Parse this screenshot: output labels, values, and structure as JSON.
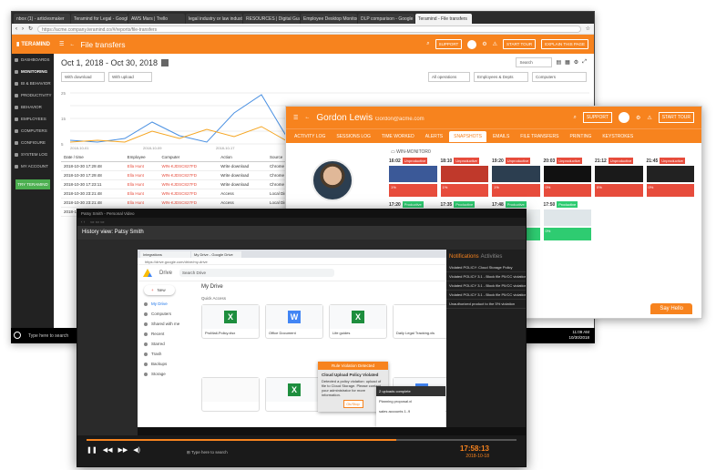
{
  "win1": {
    "tabs": [
      "nbox (1) - articlesmaker",
      "Teramind for Legal - Google",
      "AWS Mars | Trello",
      "legal industry or law indust",
      "RESOURCES | Digital Guardi",
      "Employee Desktop Monitor",
      "DLP comparison - Google D",
      "Teramind - File transfers"
    ],
    "url": "https://acme.company.teramind.co/#/reports/file-transfers",
    "logo": "TERAMIND",
    "nav": [
      "DASHBOARDS",
      "MONITORING",
      "BI & BEHAVIOR",
      "PRODUCTIVITY",
      "BEHAVIOR",
      "EMPLOYEES",
      "COMPUTERS",
      "CONFIGURE",
      "SYSTEM LOG",
      "MY ACCOUNT"
    ],
    "nav_active": "MONITORING",
    "trial_button": "TRY TERAMIND",
    "header_title": "File transfers",
    "support": "SUPPORT",
    "start_tour": "START TOUR",
    "explain": "EXPLAIN THIS PAGE",
    "date_range": "Oct 1, 2018 - Oct 30, 2018",
    "search_placeholder": "Search",
    "filters": [
      "With download",
      "With upload",
      "All operations",
      "Employees & Depts",
      "Computers"
    ],
    "columns": [
      "Date / time",
      "Employee",
      "Computer",
      "Action",
      "Source"
    ],
    "rows": [
      [
        "2018-10-30 17:29:48",
        "Ella Hunt",
        "WIN-KJDSC827FD",
        "Write download",
        "Chrome"
      ],
      [
        "2018-10-30 17:29:48",
        "Ella Hunt",
        "WIN-KJDSC827FD",
        "Write download",
        "Chrome"
      ],
      [
        "2018-10-30 17:23:11",
        "Ella Hunt",
        "WIN-KJDSC827FD",
        "Write download",
        "Chrome"
      ],
      [
        "2018-10-30 23:21:48",
        "Ella Hunt",
        "WIN-KJDSC827FD",
        "Access",
        "Local Disk"
      ],
      [
        "2018-10-30 23:21:48",
        "Ella Hunt",
        "WIN-KJDSC827FD",
        "Access",
        "Local Disk"
      ],
      [
        "2018-10-30 23:21:48",
        "Ella Hunt",
        "WIN-KJDSC827FD",
        "Access",
        "Local Disk"
      ]
    ],
    "chart_x": [
      "2018-10-01",
      "2018-10-05",
      "2018-10-09",
      "2018-10-13",
      "2018-10-17",
      "2018-10-21",
      "2018-10-25",
      "2018-10-29"
    ],
    "chart_y": [
      "25",
      "20",
      "15",
      "10",
      "5"
    ]
  },
  "win2": {
    "name": "Gordon Lewis",
    "email": "Gordon@acme.com",
    "support": "SUPPORT",
    "start_tour": "START TOUR",
    "tabs": [
      "ACTIVITY LOG",
      "SESSIONS LOG",
      "TIME WORKED",
      "ALERTS",
      "SNAPSHOTS",
      "EMAILS",
      "FILE TRANSFERS",
      "PRINTING",
      "KEYSTROKES"
    ],
    "active_tab": "SNAPSHOTS",
    "monitor_label": "WIN-MONITOR0",
    "snapshots": [
      {
        "time": "16:02",
        "badge": "Unproductive",
        "pct": "1%"
      },
      {
        "time": "18:10",
        "badge": "Unproductive",
        "pct": "1%"
      },
      {
        "time": "19:20",
        "badge": "Unproductive",
        "pct": "1%"
      },
      {
        "time": "20:03",
        "badge": "Unproductive",
        "pct": "0%"
      },
      {
        "time": "21:12",
        "badge": "Unproductive",
        "pct": "0%"
      },
      {
        "time": "21:45",
        "badge": "Unproductive",
        "pct": "0%"
      },
      {
        "time": "17:20",
        "badge": "Productive",
        "pct": "1%"
      },
      {
        "time": "17:35",
        "badge": "Productive",
        "pct": "0%"
      },
      {
        "time": "17:48",
        "badge": "Productive",
        "pct": "0%"
      },
      {
        "time": "17:50",
        "badge": "Productive",
        "pct": "0%"
      }
    ],
    "say_hello": "Say Hello"
  },
  "win3": {
    "title": "Patsy Smith - Personal Video",
    "history": "History view: Patsy Smith",
    "drive_tabs": [
      "Integrations",
      "My Drive - Google Drive"
    ],
    "drive_url": "https://drive.google.com/drive/my-drive",
    "drive_search": "Search Drive",
    "my_drive": "My Drive",
    "quick_access": "Quick Access",
    "side": [
      "New",
      "My Drive",
      "Computers",
      "Shared with me",
      "Recent",
      "Starred",
      "Trash",
      "Backups",
      "Storage"
    ],
    "files": [
      "ProMail-Policy.xlsx",
      "Office Document",
      "Life guides",
      "Daily Legal Tracking.xls"
    ],
    "dialog_title": "Rule Violation Detected",
    "dialog_heading": "Cloud Upload Policy Violated",
    "dialog_body": "Detected a policy violation: upload of file to Cloud Storage. Please contact your administrator for more information.",
    "dialog_ok": "Ok/Stop",
    "upload_title": "2 uploads complete",
    "upload_items": [
      "Planning proposal.xl",
      "sales accounts 1..9"
    ],
    "notif_title": "Notifications",
    "notif_tab": "Activities",
    "notif_items": [
      "Violated POLICY: Cloud Storage Policy",
      "Violated POLICY 3.1 - Block file PII/CC violation",
      "Violated POLICY 3.1 - Block file PII/CC violation",
      "Violated POLICY 3.1 - Block file PII/CC violation",
      "Unauthorized product to the 5% violation"
    ],
    "player_time": "17:58:13",
    "player_date": "2018-10-18"
  },
  "taskbar": {
    "search": "Type here to search",
    "time": "11:09 AM",
    "date": "10/30/2018"
  }
}
